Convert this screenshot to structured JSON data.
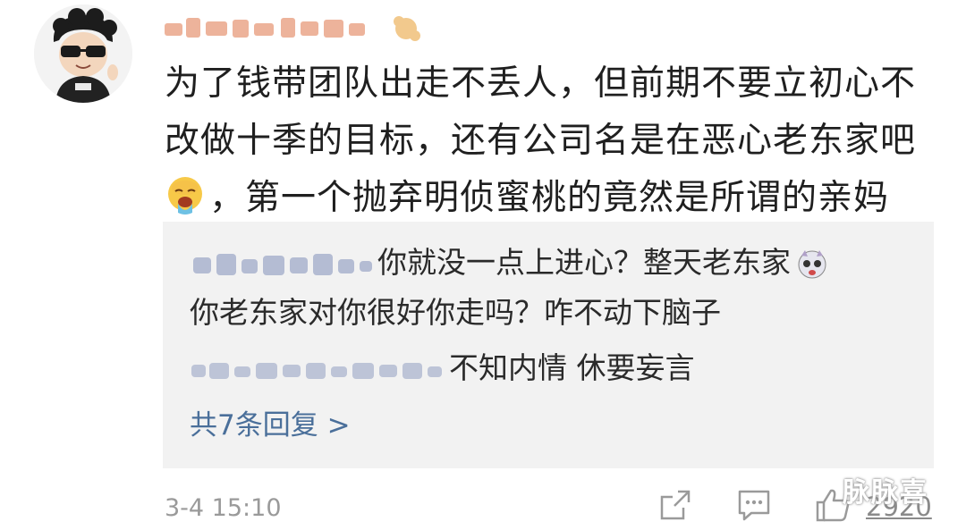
{
  "comment": {
    "text_line1": "为了钱带团队出走不丢人，但前期不要立初心不",
    "text_line2": "改做十季的目标，还有公司名是在恶心老东家吧",
    "text_line3": "，第一个抛弃明侦蜜桃的竟然是所谓的亲妈",
    "timestamp": "3-4 15:10",
    "like_count": "2920"
  },
  "replies": [
    {
      "text_a": "你就没一点上进心？整天老东家",
      "text_b": "你老东家对你很好你走吗？咋不动下脑子"
    },
    {
      "text_a": "不知内情 休要妄言"
    }
  ],
  "more_replies_label": "共7条回复 >",
  "watermark": "脉脉喜",
  "colors": {
    "link": "#4a6f9a",
    "reply_bg": "#f2f2f2",
    "meta": "#9a9a9a"
  }
}
